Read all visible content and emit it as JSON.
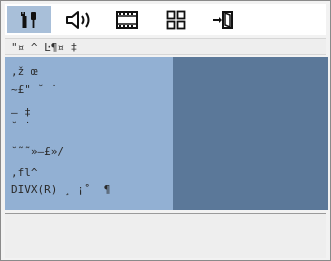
{
  "tabs": [
    {
      "icon": "setup-tools-icon",
      "active": true
    },
    {
      "icon": "speaker-icon",
      "active": false
    },
    {
      "icon": "film-icon",
      "active": false
    },
    {
      "icon": "grid-icon",
      "active": false
    },
    {
      "icon": "exit-door-icon",
      "active": false
    }
  ],
  "subtitle": "\"¤ ^ Ŀ¶¤ ‡",
  "menu": {
    "items": [
      ",ž œ",
      "~£\" ˘ ˙",
      "– ‡",
      "˘ ˙",
      "˘˜˜»–£»/",
      ",fl^",
      "DIVX(R) ¸ ¡˚  ¶"
    ]
  },
  "colors": {
    "active_tab": "#a8bfd9",
    "left_panel": "#92b0d3",
    "right_panel": "#5b7899",
    "frame_bg": "#f2f2f2"
  }
}
